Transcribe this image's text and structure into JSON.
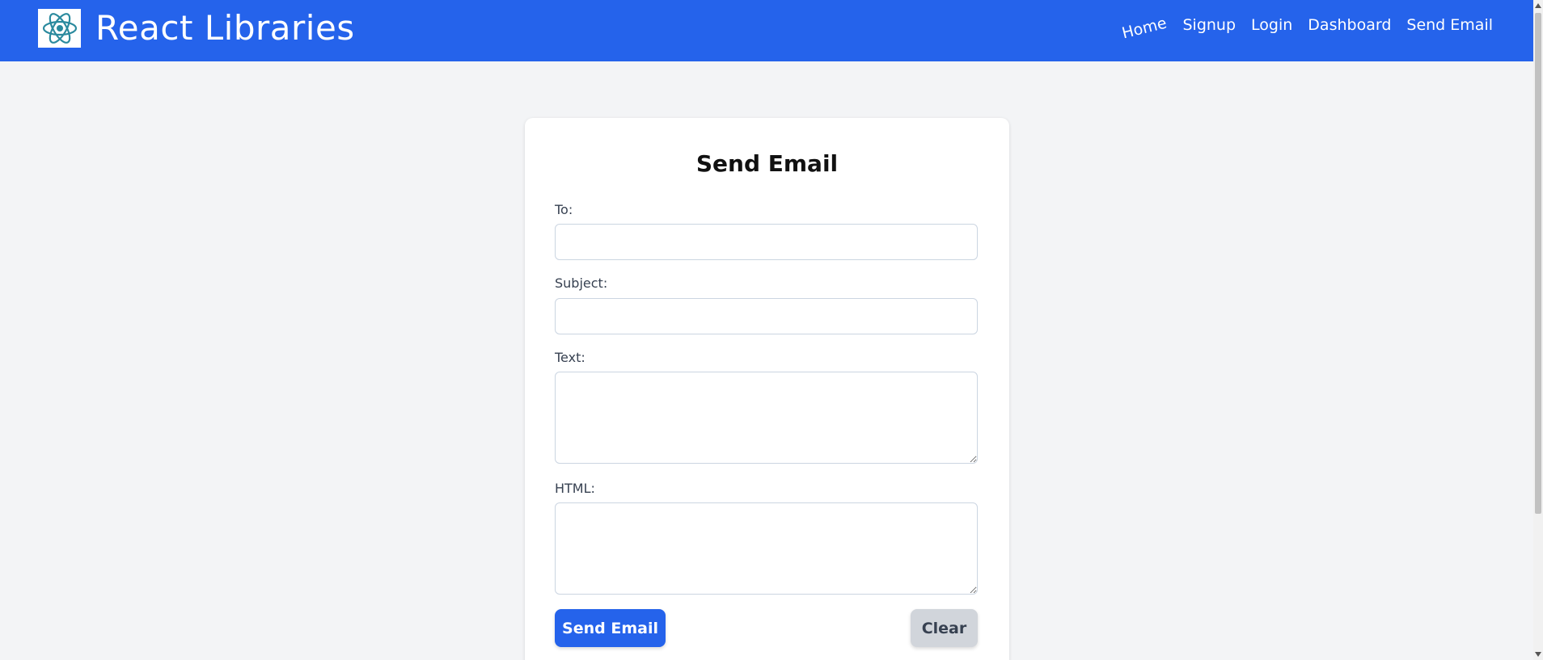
{
  "header": {
    "brand_title": "React Libraries",
    "logo_icon": "react-atom-icon",
    "nav": [
      {
        "label": "Home"
      },
      {
        "label": "Signup"
      },
      {
        "label": "Login"
      },
      {
        "label": "Dashboard"
      },
      {
        "label": "Send Email"
      }
    ]
  },
  "form": {
    "title": "Send Email",
    "to_label": "To:",
    "to_value": "",
    "subject_label": "Subject:",
    "subject_value": "",
    "text_label": "Text:",
    "text_value": "",
    "html_label": "HTML:",
    "html_value": "",
    "send_label": "Send Email",
    "clear_label": "Clear"
  },
  "colors": {
    "header_bg": "#2563eb",
    "page_bg": "#f3f4f6",
    "primary_button": "#2563eb",
    "secondary_button": "#d1d5db"
  }
}
